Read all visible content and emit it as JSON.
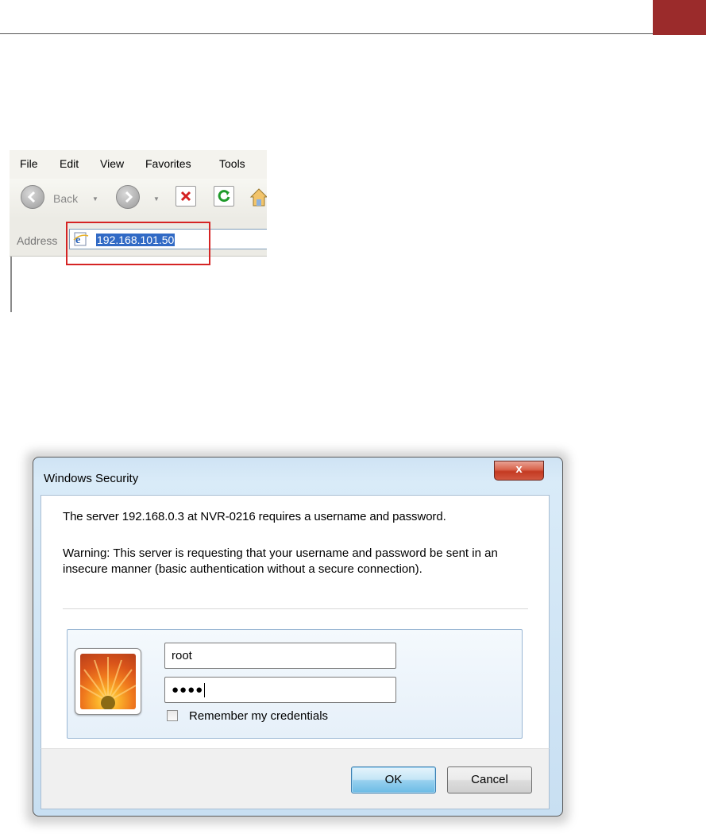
{
  "page": {
    "accent_color": "#9b2b2b"
  },
  "browser": {
    "menu": [
      "File",
      "Edit",
      "View",
      "Favorites",
      "Tools"
    ],
    "toolbar": {
      "back_label": "Back"
    },
    "address": {
      "label": "Address",
      "value": "192.168.101.50",
      "highlight_color": "#d52424"
    },
    "icons": [
      "back-arrow-icon",
      "forward-arrow-icon",
      "stop-icon",
      "refresh-icon",
      "home-icon",
      "ie-page-icon"
    ]
  },
  "dialog": {
    "title": "Windows Security",
    "close_glyph": "x",
    "server_message": "The server 192.168.0.3 at NVR-0216 requires a username and password.",
    "warning_message": "Warning: This server is requesting that your username and password be sent in an insecure manner (basic authentication without a secure connection).",
    "username_value": "root",
    "password_mask": "●●●●",
    "remember_label": "Remember my credentials",
    "remember_checked": false,
    "ok_label": "OK",
    "cancel_label": "Cancel"
  }
}
